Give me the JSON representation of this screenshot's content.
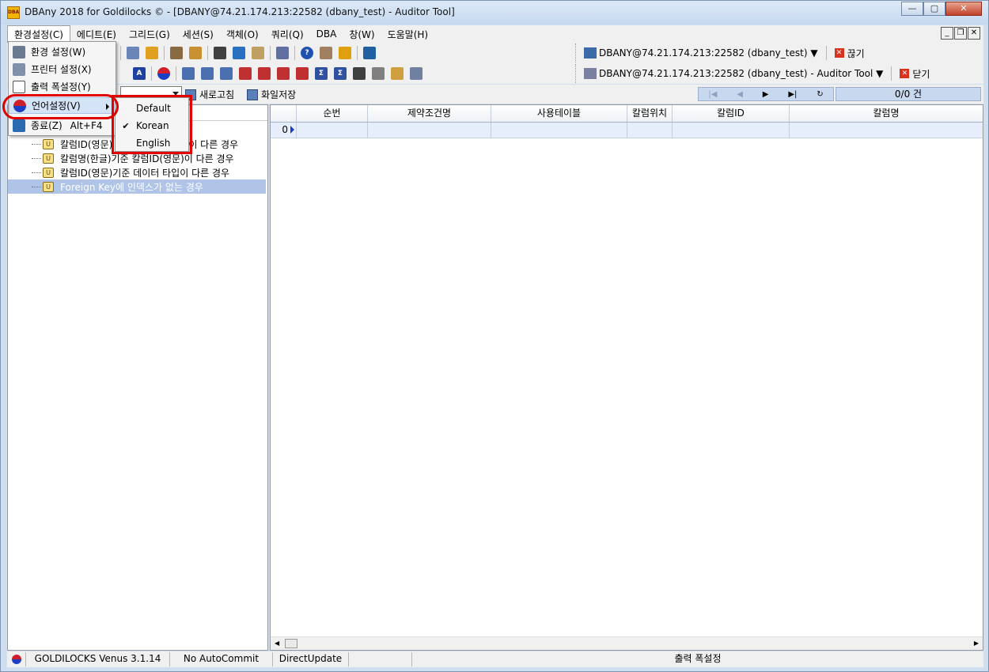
{
  "window": {
    "title": "DBAny 2018 for Goldilocks © - [DBANY@74.21.174.213:22582 (dbany_test) - Auditor Tool]",
    "icon": "DBA"
  },
  "menubar": {
    "items": [
      "환경설정(C)",
      "에디트(E)",
      "그리드(G)",
      "세션(S)",
      "객체(O)",
      "쿼리(Q)",
      "DBA",
      "창(W)",
      "도움말(H)"
    ]
  },
  "connection": {
    "conn1": "DBANY@74.21.174.213:22582 (dbany_test) ▼",
    "disconnect_label": "끊기",
    "conn2": "DBANY@74.21.174.213:22582 (dbany_test) - Auditor Tool ▼",
    "close_label": "닫기"
  },
  "row3": {
    "refresh_label": "새로고침",
    "save_file_label": "화일저장",
    "count_label": "0/0 건"
  },
  "tree": {
    "items": [
      "칼럼ID(영문)",
      "칼럼명(한글)기준 칼럼ID(영문)이 다른 경우",
      "칼럼ID(영문)기준 데이터 타입이 다른 경우",
      "Foreign Key에 인덱스가 없는 경우"
    ],
    "item1_suffix": "이 다른 경우"
  },
  "grid": {
    "columns": [
      "순번",
      "제약조건명",
      "사용테이블",
      "칼럼위치",
      "칼럼ID",
      "칼럼명"
    ],
    "row_index": "0"
  },
  "dropdown": {
    "items": [
      {
        "label": "환경 설정(W)",
        "icon": "settings-icon"
      },
      {
        "label": "프린터 설정(X)",
        "icon": "printer-icon"
      },
      {
        "label": "출력 폭설정(Y)",
        "icon": "page-icon"
      },
      {
        "label": "언어설정(V)",
        "icon": "korea-flag-icon"
      },
      {
        "label": "종료(Z)",
        "shortcut": "Alt+F4",
        "icon": "exit-icon"
      }
    ]
  },
  "language_submenu": {
    "items": [
      "Default",
      "Korean",
      "English"
    ],
    "checked": "Korean"
  },
  "statusbar": {
    "version": "GOLDILOCKS Venus 3.1.14",
    "commit_mode": "No AutoCommit",
    "update_mode": "DirectUpdate",
    "output_width": "출력 폭설정"
  }
}
